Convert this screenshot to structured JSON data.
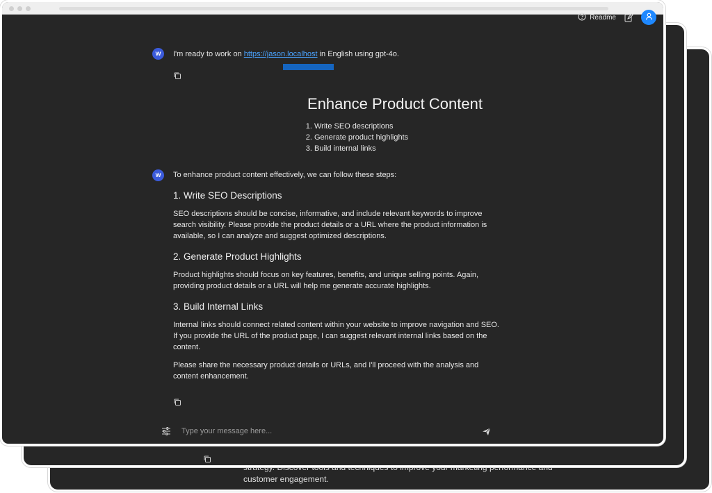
{
  "topbar": {
    "readme_label": "Readme"
  },
  "intro": {
    "avatar_letter": "w",
    "text_before": "I'm ready to work on ",
    "link_text": "https://jason.localhost",
    "text_after": " in English using gpt-4o."
  },
  "prompt": {
    "title": "Enhance Product Content",
    "items": [
      "Write SEO descriptions",
      "Generate product highlights",
      "Build internal links"
    ]
  },
  "response": {
    "avatar_letter": "w",
    "lead": "To enhance product content effectively, we can follow these steps:",
    "sections": [
      {
        "heading": "1. Write SEO Descriptions",
        "body": "SEO descriptions should be concise, informative, and include relevant keywords to improve search visibility. Please provide the product details or a URL where the product information is available, so I can analyze and suggest optimized descriptions."
      },
      {
        "heading": "2. Generate Product Highlights",
        "body": "Product highlights should focus on key features, benefits, and unique selling points. Again, providing product details or a URL will help me generate accurate highlights."
      },
      {
        "heading": "3. Build Internal Links",
        "body": "Internal links should connect related content within your website to improve navigation and SEO. If you provide the URL of the product page, I can suggest relevant internal links based on the content."
      }
    ],
    "closing": "Please share the necessary product details or URLs, and I'll proceed with the analysis and content enhancement."
  },
  "composer": {
    "placeholder": "Type your message here..."
  },
  "background_card": {
    "text": "strategy. Discover tools and techniques to improve your marketing performance and customer engagement."
  },
  "colors": {
    "panel_bg": "#262626",
    "accent_blue": "#1e88ff",
    "bot_avatar": "#3b5bdb",
    "link": "#4aa3ff"
  },
  "icons": [
    "help-circle-icon",
    "edit-icon",
    "user-icon",
    "copy-icon",
    "sliders-icon",
    "send-icon"
  ]
}
